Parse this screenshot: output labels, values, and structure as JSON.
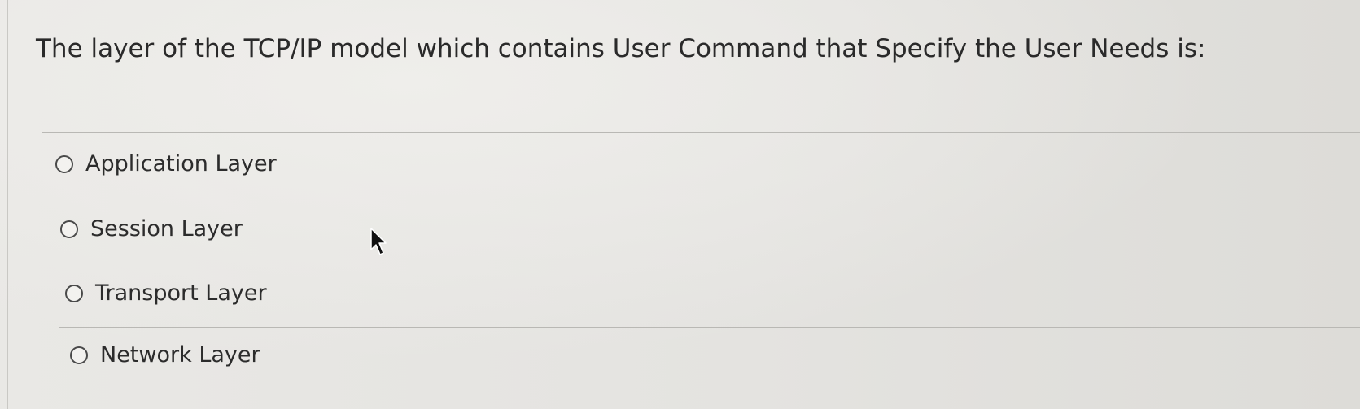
{
  "question": {
    "text": "The layer of the TCP/IP model which contains User Command that Specify the User Needs is:"
  },
  "options": [
    {
      "label": "Application Layer",
      "selected": false
    },
    {
      "label": "Session Layer",
      "selected": false
    },
    {
      "label": "Transport Layer",
      "selected": false
    },
    {
      "label": "Network Layer",
      "selected": false
    }
  ],
  "cursor": {
    "icon": "arrow-pointer-icon"
  },
  "colors": {
    "background": "#e6e5e2",
    "text": "#2b2b2b",
    "divider": "#b9b8b4"
  }
}
